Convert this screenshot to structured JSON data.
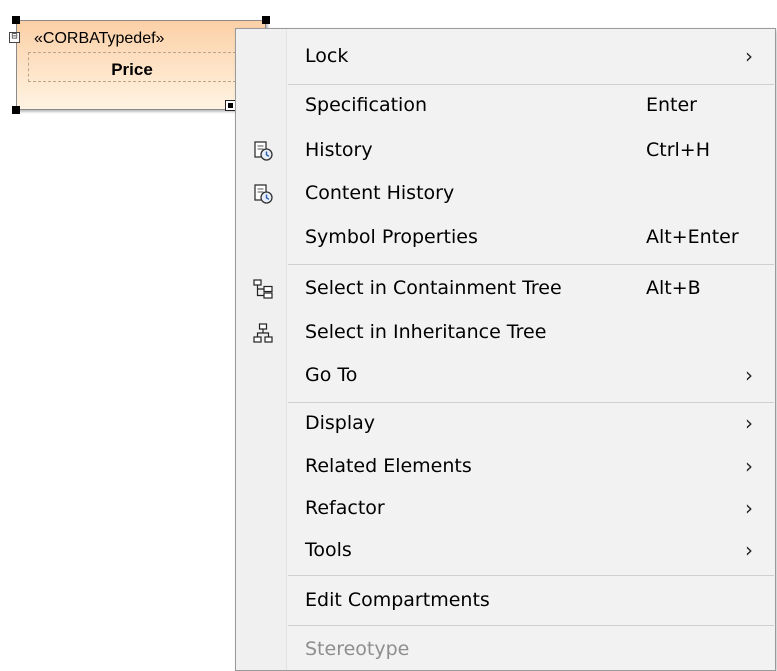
{
  "diagram_element": {
    "stereotype": "«CORBATypedef»",
    "name": "Price",
    "collapse_glyph": "⊟",
    "fill_top": "#fbd0a6",
    "fill_bottom": "#fff4e2"
  },
  "context_menu": {
    "items": [
      {
        "label": "Lock",
        "shortcut": "",
        "submenu": true,
        "icon": ""
      },
      {
        "label": "Specification",
        "shortcut": "Enter",
        "submenu": false,
        "icon": ""
      },
      {
        "label": "History",
        "shortcut": "Ctrl+H",
        "submenu": false,
        "icon": "history-icon"
      },
      {
        "label": "Content History",
        "shortcut": "",
        "submenu": false,
        "icon": "content-history-icon"
      },
      {
        "label": "Symbol Properties",
        "shortcut": "Alt+Enter",
        "submenu": false,
        "icon": ""
      },
      {
        "label": "Select in Containment Tree",
        "shortcut": "Alt+B",
        "submenu": false,
        "icon": "containment-tree-icon"
      },
      {
        "label": "Select in Inheritance Tree",
        "shortcut": "",
        "submenu": false,
        "icon": "inheritance-tree-icon"
      },
      {
        "label": "Go To",
        "shortcut": "",
        "submenu": true,
        "icon": ""
      },
      {
        "label": "Display",
        "shortcut": "",
        "submenu": true,
        "icon": ""
      },
      {
        "label": "Related Elements",
        "shortcut": "",
        "submenu": true,
        "icon": ""
      },
      {
        "label": "Refactor",
        "shortcut": "",
        "submenu": true,
        "icon": ""
      },
      {
        "label": "Tools",
        "shortcut": "",
        "submenu": true,
        "icon": ""
      },
      {
        "label": "Edit Compartments",
        "shortcut": "",
        "submenu": false,
        "icon": ""
      },
      {
        "label": "Stereotype",
        "shortcut": "",
        "submenu": false,
        "icon": "",
        "disabled": true
      }
    ],
    "submenu_arrow": "›",
    "colors": {
      "background": "#f2f2f2",
      "border": "#9a9a9a",
      "separator": "#d0d0d0",
      "disabled_text": "#8e8e8e"
    }
  }
}
